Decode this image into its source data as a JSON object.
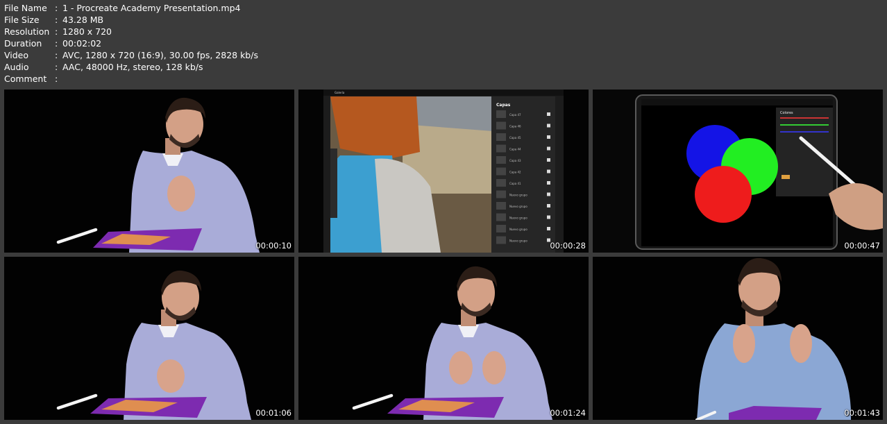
{
  "metadata": [
    {
      "key": "File Name",
      "value": "1 - Procreate Academy Presentation.mp4"
    },
    {
      "key": "File Size",
      "value": "43.28 MB"
    },
    {
      "key": "Resolution",
      "value": "1280 x 720"
    },
    {
      "key": "Duration",
      "value": "00:02:02"
    },
    {
      "key": "Video",
      "value": "AVC, 1280 x 720 (16:9), 30.00 fps, 2828 kb/s"
    },
    {
      "key": "Audio",
      "value": "AAC, 48000 Hz, stereo, 128 kb/s"
    },
    {
      "key": "Comment",
      "value": ""
    }
  ],
  "separator": ":",
  "thumbnails": [
    {
      "timestamp": "00:00:10"
    },
    {
      "timestamp": "00:00:28"
    },
    {
      "timestamp": "00:00:47"
    },
    {
      "timestamp": "00:01:06"
    },
    {
      "timestamp": "00:01:24"
    },
    {
      "timestamp": "00:01:43"
    }
  ],
  "procreate_ui": {
    "layers_title": "Capas",
    "colors_title": "Colores",
    "gallery_label": "Galería",
    "layers": [
      "Capa 47",
      "Capa 46",
      "Capa 45",
      "Capa 44",
      "Capa 43",
      "Capa 42",
      "Capa 41",
      "Nuevo grupo",
      "Nuevo grupo",
      "Nuevo grupo",
      "Nuevo grupo",
      "Nuevo grupo"
    ]
  },
  "colors": {
    "background": "#3b3b3b",
    "sweater": "#a9acd8",
    "circle_blue": "#1414e6",
    "circle_green": "#22ee22",
    "circle_red": "#ee1c1c"
  }
}
